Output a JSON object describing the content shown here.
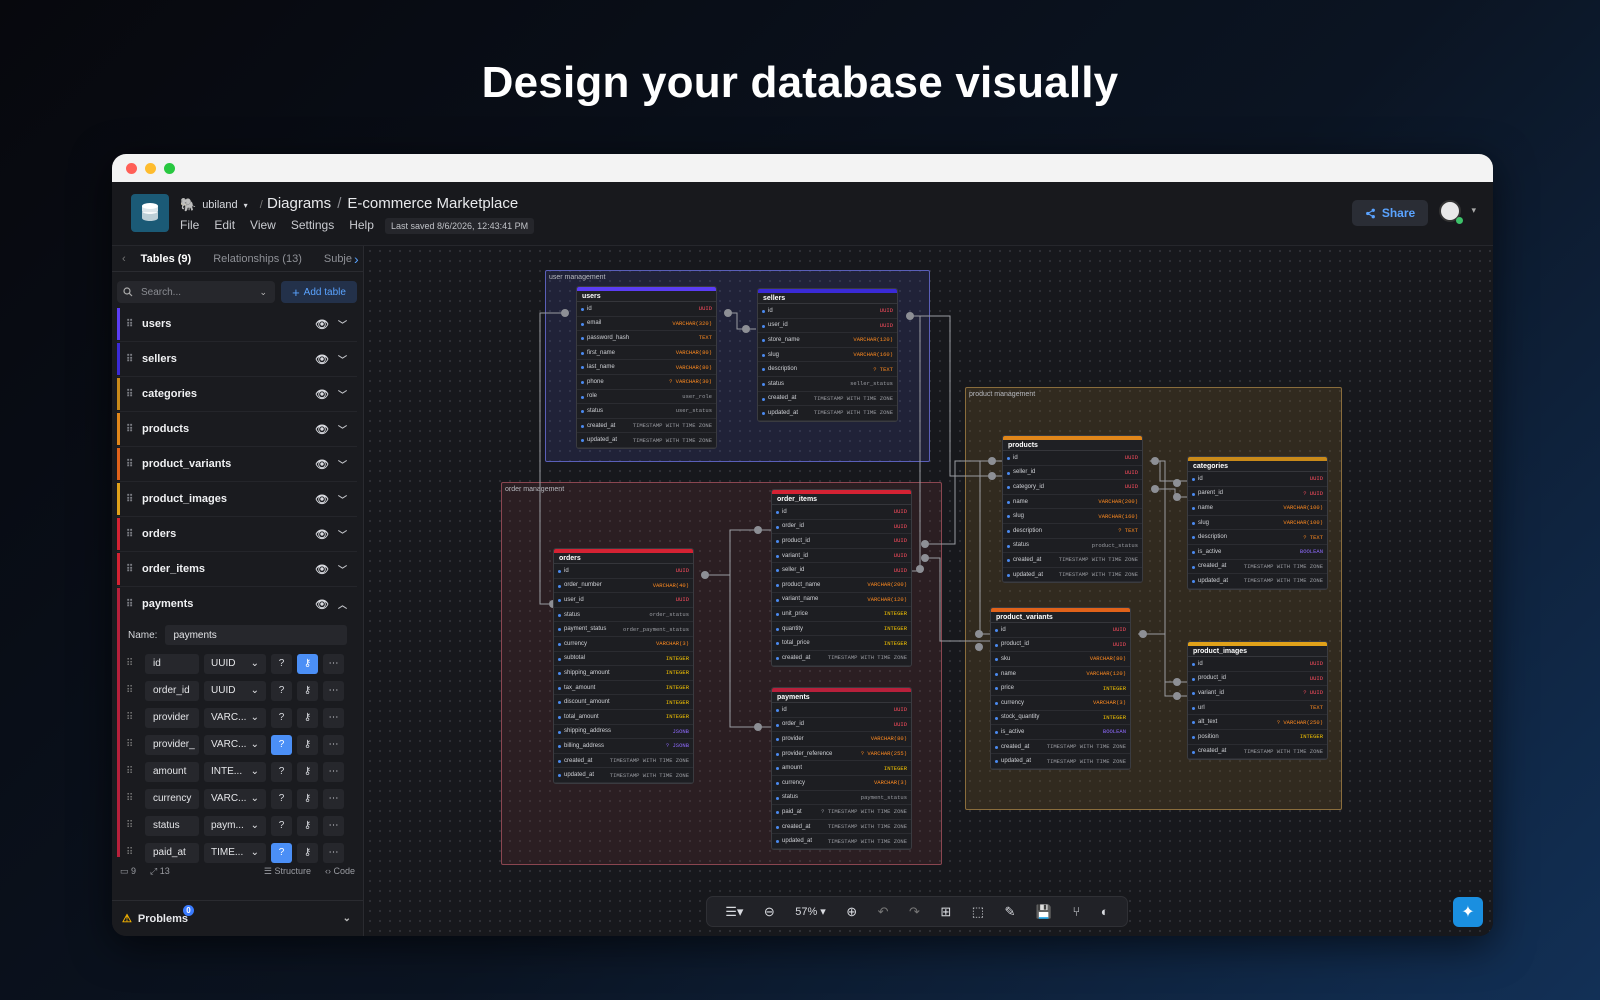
{
  "hero_title": "Design your database visually",
  "header": {
    "workspace": "ubiland",
    "breadcrumb_root": "Diagrams",
    "breadcrumb_sep": "/",
    "diagram_name": "E-commerce Marketplace",
    "menu": [
      "File",
      "Edit",
      "View",
      "Settings",
      "Help"
    ],
    "last_saved": "Last saved 8/6/2026, 12:43:41 PM",
    "share_label": "Share"
  },
  "sidebar": {
    "tabs": [
      "Tables (9)",
      "Relationships (13)",
      "Subje"
    ],
    "search_placeholder": "Search...",
    "add_table_label": "Add table",
    "tables": [
      {
        "name": "users",
        "color": "#5b3df5"
      },
      {
        "name": "sellers",
        "color": "#3a2ad6"
      },
      {
        "name": "categories",
        "color": "#c98a1a"
      },
      {
        "name": "products",
        "color": "#e0861a"
      },
      {
        "name": "product_variants",
        "color": "#e0621a"
      },
      {
        "name": "product_images",
        "color": "#e0a11a"
      },
      {
        "name": "orders",
        "color": "#d42233"
      },
      {
        "name": "order_items",
        "color": "#d42233"
      },
      {
        "name": "payments",
        "color": "#b7203b"
      }
    ],
    "editor": {
      "name_label": "Name:",
      "name_value": "payments",
      "fields": [
        {
          "name": "id",
          "type": "UUID"
        },
        {
          "name": "order_id",
          "type": "UUID"
        },
        {
          "name": "provider",
          "type": "VARC..."
        },
        {
          "name": "provider_",
          "type": "VARC..."
        },
        {
          "name": "amount",
          "type": "INTE..."
        },
        {
          "name": "currency",
          "type": "VARC..."
        },
        {
          "name": "status",
          "type": "paym..."
        },
        {
          "name": "paid_at",
          "type": "TIME..."
        }
      ]
    },
    "footer": {
      "tables_count": "9",
      "relationships_count": "13",
      "structure": "Structure",
      "code": "Code"
    },
    "problems_label": "Problems",
    "problems_count": "0"
  },
  "canvas": {
    "zoom": "57%",
    "areas": [
      "user management",
      "order management",
      "product management"
    ],
    "tables": {
      "users": {
        "title": "users",
        "fields": [
          [
            "id",
            "UUID"
          ],
          [
            "email",
            "VARCHAR(320)"
          ],
          [
            "password_hash",
            "TEXT"
          ],
          [
            "first_name",
            "VARCHAR(80)"
          ],
          [
            "last_name",
            "VARCHAR(80)"
          ],
          [
            "phone",
            "? VARCHAR(30)"
          ],
          [
            "role",
            "user_role"
          ],
          [
            "status",
            "user_status"
          ],
          [
            "created_at",
            "TIMESTAMP WITH TIME ZONE"
          ],
          [
            "updated_at",
            "TIMESTAMP WITH TIME ZONE"
          ]
        ]
      },
      "sellers": {
        "title": "sellers",
        "fields": [
          [
            "id",
            "UUID"
          ],
          [
            "user_id",
            "UUID"
          ],
          [
            "store_name",
            "VARCHAR(120)"
          ],
          [
            "slug",
            "VARCHAR(160)"
          ],
          [
            "description",
            "? TEXT"
          ],
          [
            "status",
            "seller_status"
          ],
          [
            "created_at",
            "TIMESTAMP WITH TIME ZONE"
          ],
          [
            "updated_at",
            "TIMESTAMP WITH TIME ZONE"
          ]
        ]
      },
      "orders": {
        "title": "orders",
        "fields": [
          [
            "id",
            "UUID"
          ],
          [
            "order_number",
            "VARCHAR(40)"
          ],
          [
            "user_id",
            "UUID"
          ],
          [
            "status",
            "order_status"
          ],
          [
            "payment_status",
            "order_payment_status"
          ],
          [
            "currency",
            "VARCHAR(3)"
          ],
          [
            "subtotal",
            "INTEGER"
          ],
          [
            "shipping_amount",
            "INTEGER"
          ],
          [
            "tax_amount",
            "INTEGER"
          ],
          [
            "discount_amount",
            "INTEGER"
          ],
          [
            "total_amount",
            "INTEGER"
          ],
          [
            "shipping_address",
            "JSONB"
          ],
          [
            "billing_address",
            "? JSONB"
          ],
          [
            "created_at",
            "TIMESTAMP WITH TIME ZONE"
          ],
          [
            "updated_at",
            "TIMESTAMP WITH TIME ZONE"
          ]
        ]
      },
      "order_items": {
        "title": "order_items",
        "fields": [
          [
            "id",
            "UUID"
          ],
          [
            "order_id",
            "UUID"
          ],
          [
            "product_id",
            "UUID"
          ],
          [
            "variant_id",
            "UUID"
          ],
          [
            "seller_id",
            "UUID"
          ],
          [
            "product_name",
            "VARCHAR(200)"
          ],
          [
            "variant_name",
            "VARCHAR(120)"
          ],
          [
            "unit_price",
            "INTEGER"
          ],
          [
            "quantity",
            "INTEGER"
          ],
          [
            "total_price",
            "INTEGER"
          ],
          [
            "created_at",
            "TIMESTAMP WITH TIME ZONE"
          ]
        ]
      },
      "payments": {
        "title": "payments",
        "fields": [
          [
            "id",
            "UUID"
          ],
          [
            "order_id",
            "UUID"
          ],
          [
            "provider",
            "VARCHAR(80)"
          ],
          [
            "provider_reference",
            "? VARCHAR(255)"
          ],
          [
            "amount",
            "INTEGER"
          ],
          [
            "currency",
            "VARCHAR(3)"
          ],
          [
            "status",
            "payment_status"
          ],
          [
            "paid_at",
            "? TIMESTAMP WITH TIME ZONE"
          ],
          [
            "created_at",
            "TIMESTAMP WITH TIME ZONE"
          ],
          [
            "updated_at",
            "TIMESTAMP WITH TIME ZONE"
          ]
        ]
      },
      "products": {
        "title": "products",
        "fields": [
          [
            "id",
            "UUID"
          ],
          [
            "seller_id",
            "UUID"
          ],
          [
            "category_id",
            "UUID"
          ],
          [
            "name",
            "VARCHAR(200)"
          ],
          [
            "slug",
            "VARCHAR(160)"
          ],
          [
            "description",
            "? TEXT"
          ],
          [
            "status",
            "product_status"
          ],
          [
            "created_at",
            "TIMESTAMP WITH TIME ZONE"
          ],
          [
            "updated_at",
            "TIMESTAMP WITH TIME ZONE"
          ]
        ]
      },
      "categories": {
        "title": "categories",
        "fields": [
          [
            "id",
            "UUID"
          ],
          [
            "parent_id",
            "? UUID"
          ],
          [
            "name",
            "VARCHAR(100)"
          ],
          [
            "slug",
            "VARCHAR(100)"
          ],
          [
            "description",
            "? TEXT"
          ],
          [
            "is_active",
            "BOOLEAN"
          ],
          [
            "created_at",
            "TIMESTAMP WITH TIME ZONE"
          ],
          [
            "updated_at",
            "TIMESTAMP WITH TIME ZONE"
          ]
        ]
      },
      "product_variants": {
        "title": "product_variants",
        "fields": [
          [
            "id",
            "UUID"
          ],
          [
            "product_id",
            "UUID"
          ],
          [
            "sku",
            "VARCHAR(80)"
          ],
          [
            "name",
            "VARCHAR(120)"
          ],
          [
            "price",
            "INTEGER"
          ],
          [
            "currency",
            "VARCHAR(3)"
          ],
          [
            "stock_quantity",
            "INTEGER"
          ],
          [
            "is_active",
            "BOOLEAN"
          ],
          [
            "created_at",
            "TIMESTAMP WITH TIME ZONE"
          ],
          [
            "updated_at",
            "TIMESTAMP WITH TIME ZONE"
          ]
        ]
      },
      "product_images": {
        "title": "product_images",
        "fields": [
          [
            "id",
            "UUID"
          ],
          [
            "product_id",
            "UUID"
          ],
          [
            "variant_id",
            "? UUID"
          ],
          [
            "url",
            "TEXT"
          ],
          [
            "alt_text",
            "? VARCHAR(250)"
          ],
          [
            "position",
            "INTEGER"
          ],
          [
            "created_at",
            "TIMESTAMP WITH TIME ZONE"
          ]
        ]
      }
    }
  }
}
